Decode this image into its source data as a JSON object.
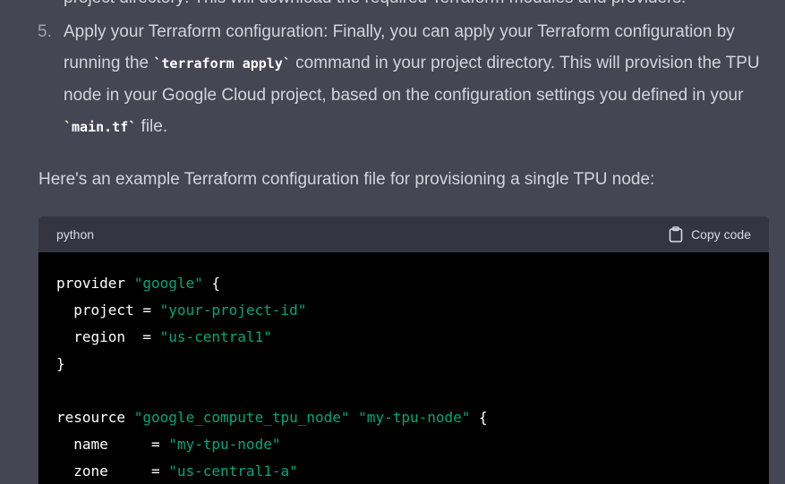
{
  "top_partial": "project directory: This will download the required Terraform modules and providers.",
  "step5": {
    "number": "5.",
    "text_before": "Apply your Terraform configuration: Finally, you can apply your Terraform configuration by running the ",
    "code1": "`terraform apply`",
    "text_mid": " command in your project directory. This will provision the TPU node in your Google Cloud project, based on the configuration settings you defined in your ",
    "code2": "`main.tf`",
    "text_after": " file."
  },
  "paragraph": "Here's an example Terraform configuration file for provisioning a single TPU node:",
  "code_block": {
    "language": "python",
    "copy_label": "Copy code",
    "lines": [
      [
        {
          "t": "provider ",
          "c": "plain"
        },
        {
          "t": "\"google\"",
          "c": "str"
        },
        {
          "t": " {",
          "c": "plain"
        }
      ],
      [
        {
          "t": "  project = ",
          "c": "plain"
        },
        {
          "t": "\"your-project-id\"",
          "c": "str"
        }
      ],
      [
        {
          "t": "  region  = ",
          "c": "plain"
        },
        {
          "t": "\"us-central1\"",
          "c": "str"
        }
      ],
      [
        {
          "t": "}",
          "c": "plain"
        }
      ],
      [],
      [
        {
          "t": "resource ",
          "c": "plain"
        },
        {
          "t": "\"google_compute_tpu_node\"",
          "c": "str"
        },
        {
          "t": " ",
          "c": "plain"
        },
        {
          "t": "\"my-tpu-node\"",
          "c": "str"
        },
        {
          "t": " {",
          "c": "plain"
        }
      ],
      [
        {
          "t": "  name     = ",
          "c": "plain"
        },
        {
          "t": "\"my-tpu-node\"",
          "c": "str"
        }
      ],
      [
        {
          "t": "  zone     = ",
          "c": "plain"
        },
        {
          "t": "\"us-central1-a\"",
          "c": "str"
        }
      ]
    ]
  },
  "colors": {
    "background": "#444654",
    "code_header": "#343541",
    "code_background": "#000000",
    "string": "#00a67d",
    "text": "#d1d5db"
  }
}
